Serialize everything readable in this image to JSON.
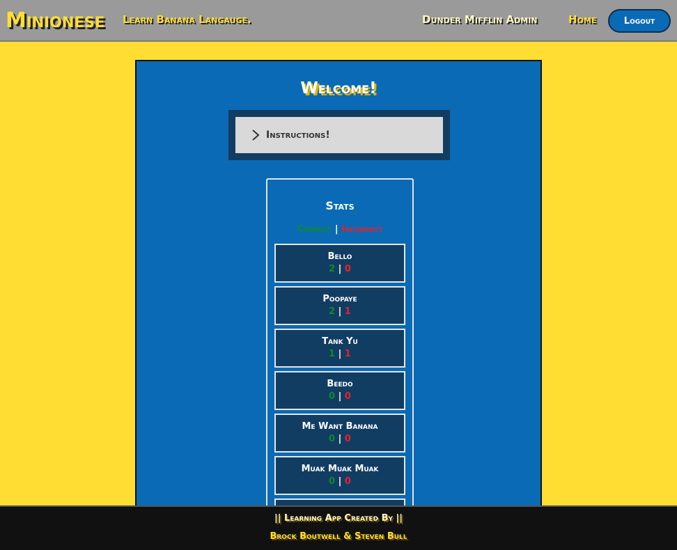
{
  "header": {
    "logo": "Minionese",
    "tagline": "Learn Banana Langauge.",
    "user": "Dunder Mifflin Admin",
    "home": "Home",
    "logout": "Logout"
  },
  "main": {
    "welcome": "Welcome!",
    "instructions_label": "Instructions!",
    "stats": {
      "title": "Stats",
      "correct_label": "Correct",
      "separator": "|",
      "incorrect_label": "Incorrect",
      "words": [
        {
          "word": "Bello",
          "correct": "2",
          "incorrect": "0"
        },
        {
          "word": "Poopaye",
          "correct": "2",
          "incorrect": "1"
        },
        {
          "word": "Tank Yu",
          "correct": "1",
          "incorrect": "1"
        },
        {
          "word": "Beedo",
          "correct": "0",
          "incorrect": "0"
        },
        {
          "word": "Me Want Banana",
          "correct": "0",
          "incorrect": "0"
        },
        {
          "word": "Muak Muak Muak",
          "correct": "0",
          "incorrect": "0"
        }
      ]
    }
  },
  "footer": {
    "line1": "|| Learning App Created By ||",
    "line2": "Brock Boutwell & Steven Bull"
  },
  "colors": {
    "background": "#ffdd33",
    "panel": "#0a6ab5",
    "card": "#123d63",
    "correct": "#0f8a2a",
    "incorrect": "#e8202a"
  }
}
